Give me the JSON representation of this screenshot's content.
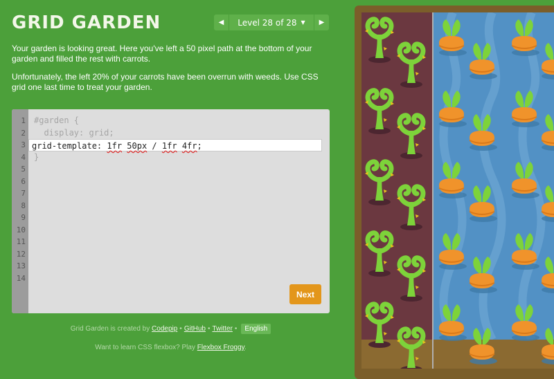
{
  "app": {
    "title": "GRID GARDEN"
  },
  "level_nav": {
    "prev_icon": "triangle-left-icon",
    "label": "Level 28 of 28",
    "dropdown_icon": "caret-down-icon",
    "next_icon": "triangle-right-icon"
  },
  "instructions": [
    "Your garden is looking great. Here you've left a 50 pixel path at the bottom of your garden and filled the rest with carrots.",
    "Unfortunately, the left 20% of your carrots have been overrun with weeds. Use CSS grid one last time to treat your garden."
  ],
  "editor": {
    "line_numbers": [
      "1",
      "2",
      "3",
      "4",
      "5",
      "6",
      "7",
      "8",
      "9",
      "10",
      "11",
      "12",
      "13",
      "14"
    ],
    "code": {
      "line1": "#garden {",
      "line2": "  display: grid;",
      "line4": "}"
    },
    "input": {
      "prefix": "grid-template: ",
      "t1": "1fr",
      "t2": "50px",
      "slash": " / ",
      "t3": "1fr",
      "t4": "4fr",
      "suffix": ";"
    },
    "next_label": "Next"
  },
  "footer": {
    "created_by": "Grid Garden is created by",
    "links": [
      "Codepip",
      "GitHub",
      "Twitter"
    ],
    "separator": "•",
    "language": "English",
    "froggy_text": "Want to learn CSS flexbox? Play",
    "froggy_link": "Flexbox Froggy",
    "froggy_end": "."
  },
  "garden": {
    "colors": {
      "background": "#4ca03a",
      "weed_soil": "#6b3840",
      "water": "#5291c5",
      "path": "#8b6a31",
      "carrot": "#f0932b",
      "leaf": "#7dd33a",
      "button": "#e3961b"
    },
    "weed_icon": "weed-icon",
    "carrot_icon": "carrot-icon"
  }
}
